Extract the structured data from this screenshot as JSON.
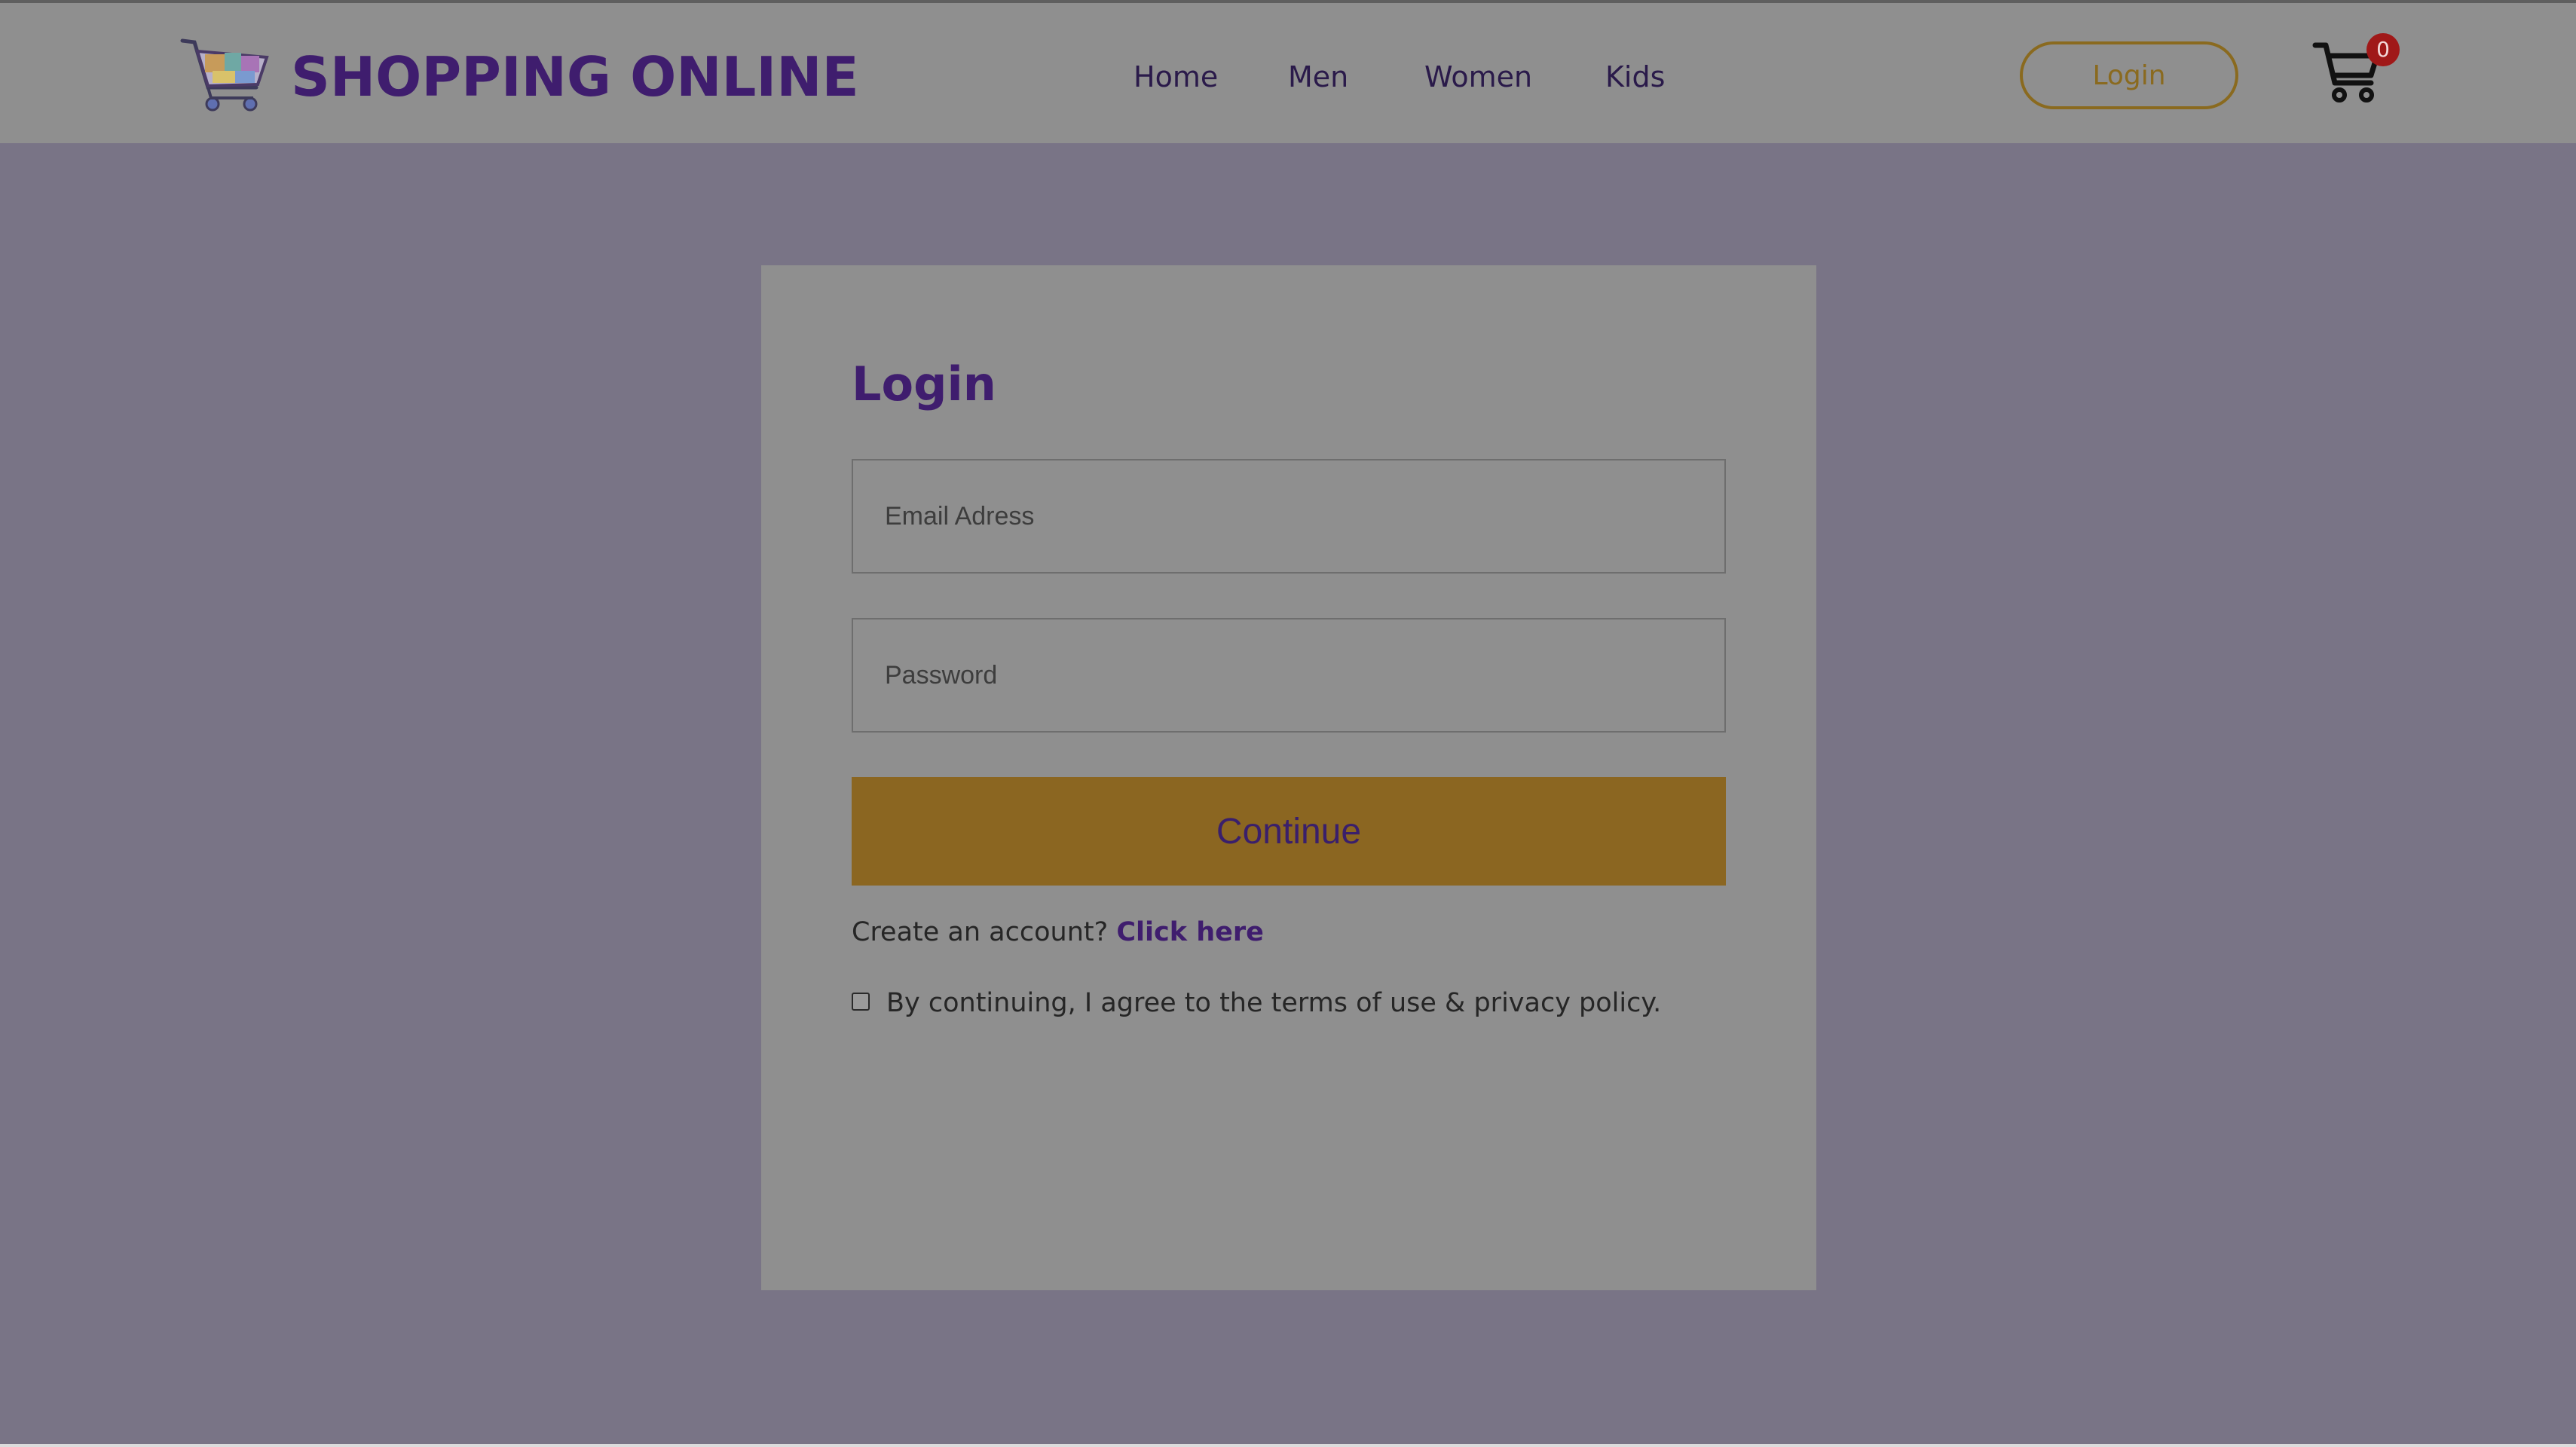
{
  "header": {
    "brand": "SHOPPING ONLINE",
    "logo_icon": "shopping-cart-logo",
    "nav": [
      {
        "label": "Home"
      },
      {
        "label": "Men"
      },
      {
        "label": "Women"
      },
      {
        "label": "Kids"
      }
    ],
    "login_label": "Login",
    "cart_icon": "cart-icon",
    "cart_count": "0"
  },
  "login_form": {
    "title": "Login",
    "email_placeholder": "Email Adress",
    "email_value": "",
    "password_placeholder": "Password",
    "password_value": "",
    "continue_label": "Continue",
    "create_prompt": "Create an account?",
    "create_link": "Click here",
    "agree_text": "By continuing, I agree to the terms of use & privacy policy.",
    "agree_checked": false
  },
  "colors": {
    "page_overlay": "#797486",
    "header_bg": "#8f8f8f",
    "card_bg": "#8f8f8f",
    "brand_purple": "#3f1d6e",
    "accent_gold": "#8b6621",
    "badge_red": "#a01818"
  }
}
